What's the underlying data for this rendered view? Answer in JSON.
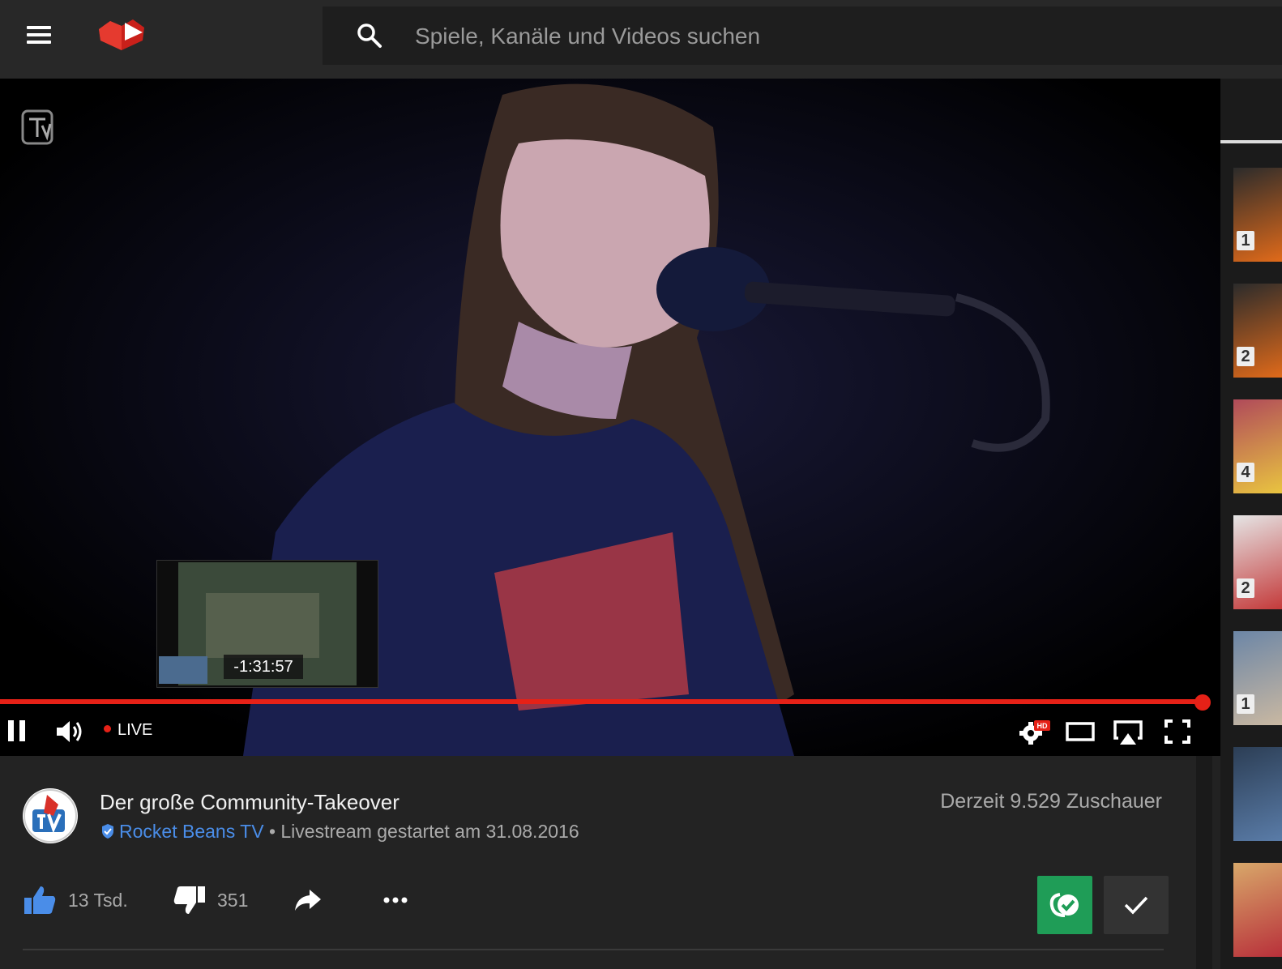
{
  "header": {
    "search_placeholder": "Spiele, Kanäle und Videos suchen"
  },
  "player": {
    "preview_time": "-1:31:57",
    "live_label": "LIVE",
    "progress_fraction": 1.0,
    "hd_badge": "HD"
  },
  "video": {
    "title": "Der große Community-Takeover",
    "channel": "Rocket Beans TV",
    "meta": "• Livestream gestartet am 31.08.2016",
    "viewers": "Derzeit 9.529 Zuschauer"
  },
  "actions": {
    "likes": "13 Tsd.",
    "dislikes": "351"
  },
  "sidebar": {
    "thumbnails": [
      {
        "badge": "1"
      },
      {
        "badge": "2"
      },
      {
        "badge": "4"
      },
      {
        "badge": "2"
      },
      {
        "badge": "1"
      },
      {
        "badge": ""
      },
      {
        "badge": ""
      }
    ]
  },
  "colors": {
    "accent_red": "#e62117",
    "subscribe_green": "#1f9d57",
    "channel_blue": "#4a8de8"
  }
}
